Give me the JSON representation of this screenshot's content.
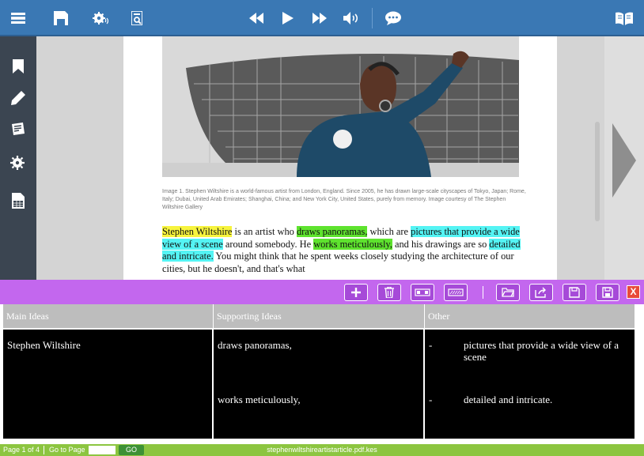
{
  "topbar": {
    "icons": [
      "menu-icon",
      "save-icon",
      "settings-speech-icon",
      "document-scan-icon",
      "rewind-icon",
      "play-icon",
      "fast-forward-icon",
      "volume-icon",
      "chat-icon",
      "book-icon"
    ]
  },
  "sidebar": {
    "icons": [
      "bookmark-icon",
      "pencil-icon",
      "notes-icon",
      "settings-icon",
      "worksheet-icon"
    ]
  },
  "document": {
    "caption": "Image 1. Stephen Wiltshire is a world-famous artist from London, England. Since 2005, he has drawn large-scale cityscapes of Tokyo, Japan; Rome, Italy; Dubai, United Arab Emirates; Shanghai, China; and New York City, United States, purely from memory. Image courtesy of The Stephen Wiltshire Gallery",
    "t1": "Stephen Wiltshire",
    "t2": " is an artist who ",
    "t3": "draws panoramas,",
    "t4": " which are ",
    "t5": "pictures that provide a wide view of a scene",
    "t6": " around somebody. He ",
    "t7": "works meticulously,",
    "t8": " and his drawings are so ",
    "t9": "detailed and intricate.",
    "t10": " You might think that he spent weeks closely studying the architecture of our cities, but he doesn't, and that's what"
  },
  "table": {
    "headers": [
      "Main Ideas",
      "Supporting Ideas",
      "Other"
    ],
    "rows": [
      {
        "main": "Stephen Wiltshire",
        "supporting": "draws panoramas,",
        "other_dash": "-",
        "other": "pictures that provide a wide view of a scene"
      },
      {
        "main": "",
        "supporting": "works meticulously,",
        "other_dash": "-",
        "other": "detailed and intricate."
      }
    ]
  },
  "toolbar": {
    "close_label": "X"
  },
  "status": {
    "page": "Page 1 of 4",
    "goto": "Go to Page",
    "go_button": "GO",
    "filename": "stephenwiltshireartistarticle.pdf.kes",
    "page_input": ""
  },
  "colors": {
    "topbar": "#3a78b4",
    "sidebar": "#3b4551",
    "toolbar": "#c367ee",
    "statusbar": "#8cc540",
    "highlight_yellow": "#f7f43d",
    "highlight_green": "#5ee32e",
    "highlight_cyan": "#54f4f4"
  }
}
